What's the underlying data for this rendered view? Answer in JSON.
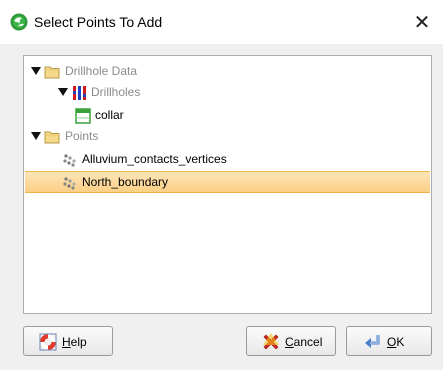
{
  "window": {
    "title": "Select Points To Add",
    "close_glyph": "✕"
  },
  "tree": [
    {
      "label": "Drillhole Data",
      "icon": "folder-icon",
      "expanded": true,
      "muted": true
    },
    {
      "label": "Drillholes",
      "icon": "drillholes-icon",
      "expanded": true,
      "muted": true
    },
    {
      "label": "collar",
      "icon": "table-icon",
      "muted": false
    },
    {
      "label": "Points",
      "icon": "folder-icon",
      "expanded": true,
      "muted": true
    },
    {
      "label": "Alluvium_contacts_vertices",
      "icon": "points-icon",
      "muted": false
    },
    {
      "label": "North_boundary",
      "icon": "points-icon",
      "muted": false,
      "selected": true
    }
  ],
  "buttons": {
    "help": {
      "mnemonic": "H",
      "rest": "elp",
      "icon": "lifebuoy-icon"
    },
    "cancel": {
      "mnemonic": "C",
      "rest": "ancel",
      "icon": "red-x-icon"
    },
    "ok": {
      "mnemonic": "O",
      "rest": "K",
      "icon": "enter-arrow-icon"
    }
  },
  "colors": {
    "selection": "#fbcf86",
    "folder": "#f5d98a",
    "drillhole_red": "#d11a1a",
    "drillhole_blue": "#1d3fc2"
  }
}
